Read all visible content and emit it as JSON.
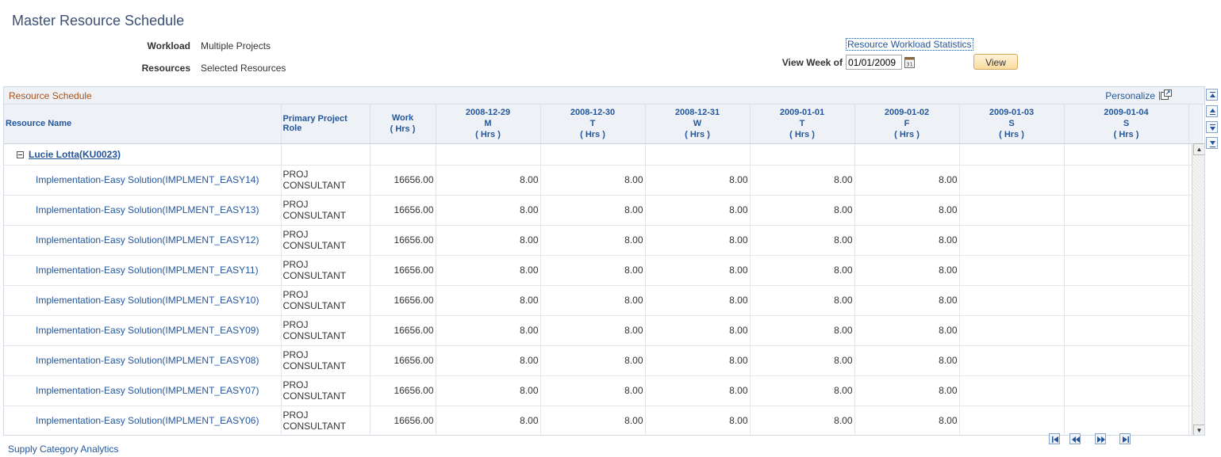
{
  "page": {
    "title": "Master Resource Schedule"
  },
  "filters": {
    "workload_label": "Workload",
    "workload_value": "Multiple Projects",
    "resources_label": "Resources",
    "resources_value": "Selected Resources"
  },
  "stats_link": "Resource Workload Statistics",
  "view_week": {
    "label": "View Week of",
    "value": "01/01/2009",
    "button": "View"
  },
  "grid": {
    "title": "Resource Schedule",
    "personalize": "Personalize",
    "separator": "|",
    "columns": {
      "resource_name": "Resource Name",
      "role": "Primary Project Role",
      "work": "Work",
      "hrs": "( Hrs )",
      "days": [
        {
          "date": "2008-12-29",
          "day": "M"
        },
        {
          "date": "2008-12-30",
          "day": "T"
        },
        {
          "date": "2008-12-31",
          "day": "W"
        },
        {
          "date": "2009-01-01",
          "day": "T"
        },
        {
          "date": "2009-01-02",
          "day": "F"
        },
        {
          "date": "2009-01-03",
          "day": "S"
        },
        {
          "date": "2009-01-04",
          "day": "S"
        }
      ]
    },
    "group": {
      "label": "Lucie Lotta(KU0023)"
    },
    "rows": [
      {
        "name": "Implementation-Easy Solution(IMPLMENT_EASY14)",
        "role_l1": "PROJ",
        "role_l2": "CONSULTANT",
        "work": "16656.00",
        "d1": "8.00",
        "d2": "8.00",
        "d3": "8.00",
        "d4": "8.00",
        "d5": "8.00"
      },
      {
        "name": "Implementation-Easy Solution(IMPLMENT_EASY13)",
        "role_l1": "PROJ",
        "role_l2": "CONSULTANT",
        "work": "16656.00",
        "d1": "8.00",
        "d2": "8.00",
        "d3": "8.00",
        "d4": "8.00",
        "d5": "8.00"
      },
      {
        "name": "Implementation-Easy Solution(IMPLMENT_EASY12)",
        "role_l1": "PROJ",
        "role_l2": "CONSULTANT",
        "work": "16656.00",
        "d1": "8.00",
        "d2": "8.00",
        "d3": "8.00",
        "d4": "8.00",
        "d5": "8.00"
      },
      {
        "name": "Implementation-Easy Solution(IMPLMENT_EASY11)",
        "role_l1": "PROJ",
        "role_l2": "CONSULTANT",
        "work": "16656.00",
        "d1": "8.00",
        "d2": "8.00",
        "d3": "8.00",
        "d4": "8.00",
        "d5": "8.00"
      },
      {
        "name": "Implementation-Easy Solution(IMPLMENT_EASY10)",
        "role_l1": "PROJ",
        "role_l2": "CONSULTANT",
        "work": "16656.00",
        "d1": "8.00",
        "d2": "8.00",
        "d3": "8.00",
        "d4": "8.00",
        "d5": "8.00"
      },
      {
        "name": "Implementation-Easy Solution(IMPLMENT_EASY09)",
        "role_l1": "PROJ",
        "role_l2": "CONSULTANT",
        "work": "16656.00",
        "d1": "8.00",
        "d2": "8.00",
        "d3": "8.00",
        "d4": "8.00",
        "d5": "8.00"
      },
      {
        "name": "Implementation-Easy Solution(IMPLMENT_EASY08)",
        "role_l1": "PROJ",
        "role_l2": "CONSULTANT",
        "work": "16656.00",
        "d1": "8.00",
        "d2": "8.00",
        "d3": "8.00",
        "d4": "8.00",
        "d5": "8.00"
      },
      {
        "name": "Implementation-Easy Solution(IMPLMENT_EASY07)",
        "role_l1": "PROJ",
        "role_l2": "CONSULTANT",
        "work": "16656.00",
        "d1": "8.00",
        "d2": "8.00",
        "d3": "8.00",
        "d4": "8.00",
        "d5": "8.00"
      },
      {
        "name": "Implementation-Easy Solution(IMPLMENT_EASY06)",
        "role_l1": "PROJ",
        "role_l2": "CONSULTANT",
        "work": "16656.00",
        "d1": "8.00",
        "d2": "8.00",
        "d3": "8.00",
        "d4": "8.00",
        "d5": "8.00"
      }
    ]
  },
  "icons": {
    "calendar": "calendar-icon",
    "popout": "popout-icon",
    "collapse": "collapse-icon",
    "scroll_up": "scroll-up-icon",
    "scroll_down": "scroll-down-icon",
    "first": "first-page-icon",
    "prev": "prev-page-icon",
    "next": "next-page-icon",
    "last": "last-page-icon"
  },
  "colors": {
    "link": "#24569c",
    "title": "#3c4f74",
    "grid_title": "#a4521b",
    "header_bg": "#eef2f6"
  },
  "footer_link": "Supply Category Analytics"
}
